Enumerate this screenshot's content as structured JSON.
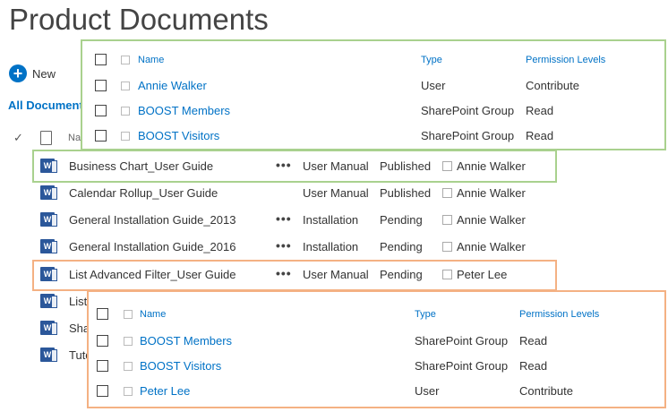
{
  "page_title": "Product Documents",
  "toolbar": {
    "new_label": "New"
  },
  "view": {
    "label": "All Document"
  },
  "list_header": {
    "name": "Na"
  },
  "documents": [
    {
      "name": "Business Chart_User Guide",
      "type": "User Manual",
      "status": "Published",
      "user": "Annie Walker",
      "show_dots": true
    },
    {
      "name": "Calendar Rollup_User Guide",
      "type": "User Manual",
      "status": "Published",
      "user": "Annie Walker",
      "show_dots": false
    },
    {
      "name": "General Installation Guide_2013",
      "type": "Installation",
      "status": "Pending",
      "user": "Annie Walker",
      "show_dots": true
    },
    {
      "name": "General Installation Guide_2016",
      "type": "Installation",
      "status": "Pending",
      "user": "Annie Walker",
      "show_dots": true
    },
    {
      "name": "List Advanced Filter_User Guide",
      "type": "User Manual",
      "status": "Pending",
      "user": "Peter Lee",
      "show_dots": true
    },
    {
      "name": "List",
      "type": "",
      "status": "",
      "user": "",
      "show_dots": false
    },
    {
      "name": "Sha",
      "type": "",
      "status": "",
      "user": "",
      "show_dots": false
    },
    {
      "name": "Tuto",
      "type": "",
      "status": "",
      "user": "",
      "show_dots": false
    }
  ],
  "row_menu_glyph": "•••",
  "permissions_green": {
    "headers": {
      "name": "Name",
      "type": "Type",
      "level": "Permission Levels"
    },
    "rows": [
      {
        "name": "Annie Walker",
        "type": "User",
        "level": "Contribute"
      },
      {
        "name": "BOOST Members",
        "type": "SharePoint Group",
        "level": "Read"
      },
      {
        "name": "BOOST Visitors",
        "type": "SharePoint Group",
        "level": "Read"
      }
    ]
  },
  "permissions_orange": {
    "headers": {
      "name": "Name",
      "type": "Type",
      "level": "Permission Levels"
    },
    "rows": [
      {
        "name": "BOOST Members",
        "type": "SharePoint Group",
        "level": "Read"
      },
      {
        "name": "BOOST Visitors",
        "type": "SharePoint Group",
        "level": "Read"
      },
      {
        "name": "Peter Lee",
        "type": "User",
        "level": "Contribute"
      }
    ]
  },
  "colors": {
    "accent": "#0072c6",
    "green_highlight": "#a9d18e",
    "orange_highlight": "#f4b183",
    "word_blue": "#2b579a"
  }
}
